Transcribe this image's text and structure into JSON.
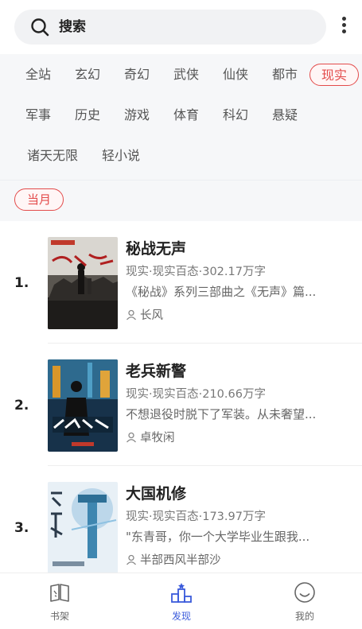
{
  "search": {
    "label": "搜索"
  },
  "categories": [
    "全站",
    "玄幻",
    "奇幻",
    "武侠",
    "仙侠",
    "都市",
    "现实",
    "军事",
    "历史",
    "游戏",
    "体育",
    "科幻",
    "悬疑",
    "诸天无限",
    "轻小说"
  ],
  "selected_category": "现实",
  "period": "当月",
  "books": [
    {
      "rank": "1.",
      "title": "秘战无声",
      "meta": "现实·现实百态·302.17万字",
      "desc": "《秘战》系列三部曲之《无声》篇...",
      "author": "长风"
    },
    {
      "rank": "2.",
      "title": "老兵新警",
      "meta": "现实·现实百态·210.66万字",
      "desc": "不想退役时脱下了军装。从未奢望...",
      "author": "卓牧闲"
    },
    {
      "rank": "3.",
      "title": "大国机修",
      "meta": "现实·现实百态·173.97万字",
      "desc": "\"东青哥，你一个大学毕业生跟我...",
      "author": "半部西风半部沙"
    }
  ],
  "tabs": [
    {
      "label": "书架",
      "icon": "book-icon"
    },
    {
      "label": "发现",
      "icon": "discover-podium-icon"
    },
    {
      "label": "我的",
      "icon": "smiley-profile-icon"
    }
  ],
  "colors": {
    "accent_red": "#e34b4b",
    "active_blue": "#3b5bdb"
  }
}
